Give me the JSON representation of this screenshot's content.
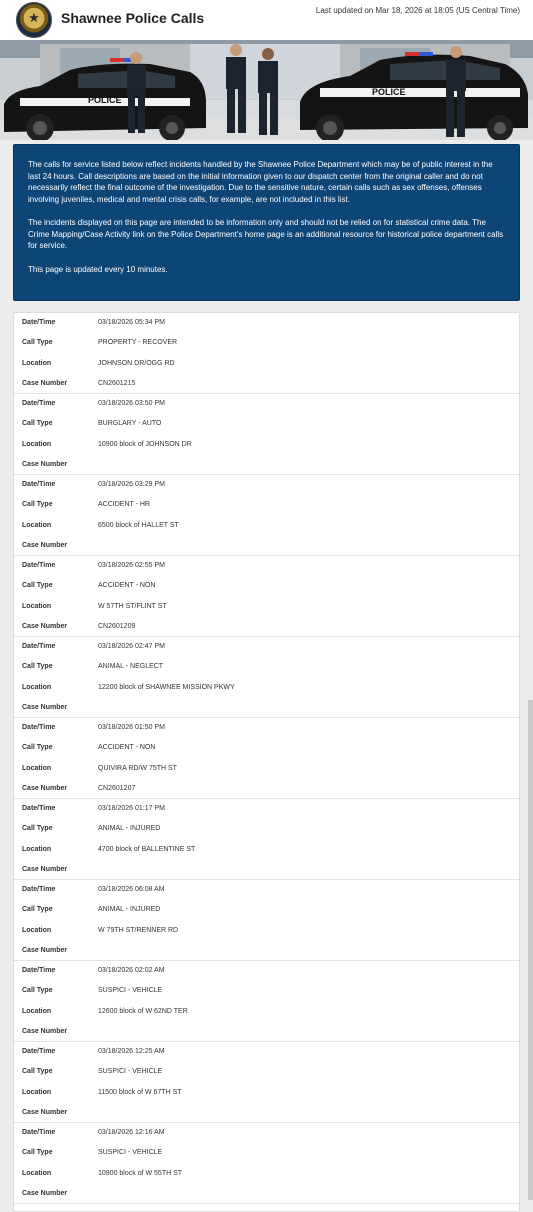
{
  "header": {
    "title": "Shawnee Police Calls",
    "last_updated": "Last updated on Mar 18, 2026 at 18:05 (US Central Time)"
  },
  "banner": {
    "car_text": "POLICE"
  },
  "notice": {
    "paragraphs": [
      "The calls for service listed below reflect incidents handled by the Shawnee Police Department which may be of public interest in the last 24 hours. Call descriptions are based on the initial information given to our dispatch center from the original caller and do not necessarily reflect the final outcome of the investigation. Due to the sensitive nature, certain calls such as sex offenses, offenses involving juveniles, medical and mental crisis calls, for example, are not included in this list.",
      "The incidents displayed on this page are intended to be information only and should not be relied on for statistical crime data. The Crime Mapping/Case Activity link on the Police Department's home page is an additional resource for historical police department calls for service.",
      "This page is updated every 10 minutes."
    ]
  },
  "labels": {
    "datetime": "Date/Time",
    "call_type": "Call Type",
    "location": "Location",
    "case_number": "Case Number"
  },
  "records": [
    {
      "datetime": "03/18/2026 05:34 PM",
      "call_type": "PROPERTY - RECOVER",
      "location": "JOHNSON DR/OGG RD",
      "case_number": "CN2601215"
    },
    {
      "datetime": "03/18/2026 03:50 PM",
      "call_type": "BURGLARY - AUTO",
      "location": "10900 block of JOHNSON DR",
      "case_number": ""
    },
    {
      "datetime": "03/18/2026 03:29 PM",
      "call_type": "ACCIDENT - HR",
      "location": "6500 block of HALLET ST",
      "case_number": ""
    },
    {
      "datetime": "03/18/2026 02:55 PM",
      "call_type": "ACCIDENT - NON",
      "location": "W 57TH ST/FLINT ST",
      "case_number": "CN2601209"
    },
    {
      "datetime": "03/18/2026 02:47 PM",
      "call_type": "ANIMAL - NEGLECT",
      "location": "12200 block of SHAWNEE MISSION PKWY",
      "case_number": ""
    },
    {
      "datetime": "03/18/2026 01:50 PM",
      "call_type": "ACCIDENT - NON",
      "location": "QUIVIRA RD/W 75TH ST",
      "case_number": "CN2601207"
    },
    {
      "datetime": "03/18/2026 01:17 PM",
      "call_type": "ANIMAL - INJURED",
      "location": "4700 block of BALLENTINE ST",
      "case_number": ""
    },
    {
      "datetime": "03/18/2026 06:08 AM",
      "call_type": "ANIMAL - INJURED",
      "location": "W 79TH ST/RENNER RD",
      "case_number": ""
    },
    {
      "datetime": "03/18/2026 02:02 AM",
      "call_type": "SUSPICI - VEHICLE",
      "location": "12600 block of W 62ND TER",
      "case_number": ""
    },
    {
      "datetime": "03/18/2026 12:25 AM",
      "call_type": "SUSPICI - VEHICLE",
      "location": "11500 block of W 67TH ST",
      "case_number": ""
    },
    {
      "datetime": "03/18/2026 12:16 AM",
      "call_type": "SUSPICI - VEHICLE",
      "location": "10900 block of W 55TH ST",
      "case_number": ""
    }
  ]
}
